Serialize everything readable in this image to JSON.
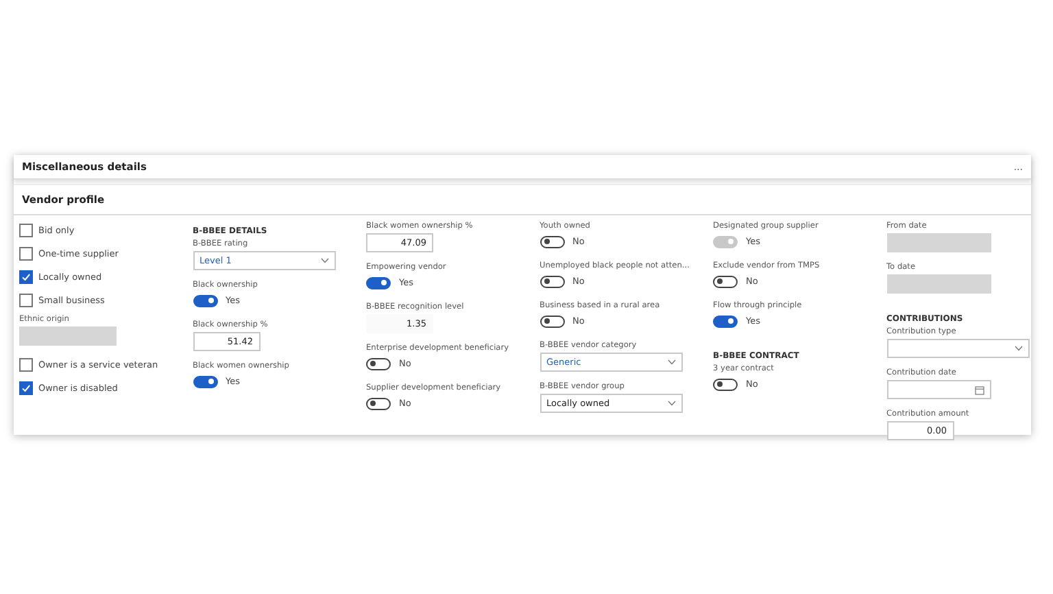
{
  "section": {
    "title": "Miscellaneous details",
    "more": "..."
  },
  "subsection": {
    "title": "Vendor profile"
  },
  "columns": [
    {
      "items": [
        {
          "kind": "checkbox",
          "label": "Bid only",
          "checked": false
        },
        {
          "kind": "checkbox",
          "label": "One-time supplier",
          "checked": false
        },
        {
          "kind": "checkbox",
          "label": "Locally owned",
          "checked": true
        },
        {
          "kind": "checkbox",
          "label": "Small business",
          "checked": false
        },
        {
          "kind": "field",
          "label": "Ethnic origin",
          "disabled": true
        },
        {
          "kind": "checkbox",
          "label": "Owner is a service veteran",
          "checked": false
        },
        {
          "kind": "checkbox",
          "label": "Owner is disabled",
          "checked": true
        }
      ]
    },
    {
      "items": [
        {
          "kind": "heading",
          "label": "B-BBEE DETAILS"
        },
        {
          "kind": "select",
          "label": "B-BBEE rating",
          "value": "Level 1",
          "accent": true
        },
        {
          "kind": "toggle",
          "label": "Black ownership",
          "on": true,
          "disabled": false,
          "text": "Yes"
        },
        {
          "kind": "number",
          "label": "Black ownership %",
          "value": "51.42"
        },
        {
          "kind": "toggle",
          "label": "Black women ownership",
          "on": true,
          "disabled": false,
          "text": "Yes"
        }
      ]
    },
    {
      "items": [
        {
          "kind": "number",
          "label": "Black women ownership %",
          "value": "47.09"
        },
        {
          "kind": "toggle",
          "label": "Empowering vendor",
          "on": true,
          "disabled": false,
          "text": "Yes"
        },
        {
          "kind": "readonly",
          "label": "B-BBEE recognition level",
          "value": "1.35"
        },
        {
          "kind": "toggle",
          "label": "Enterprise development beneficiary",
          "on": false,
          "disabled": false,
          "text": "No"
        },
        {
          "kind": "toggle",
          "label": "Supplier development beneficiary",
          "on": false,
          "disabled": false,
          "text": "No"
        }
      ]
    },
    {
      "items": [
        {
          "kind": "toggle",
          "label": "Youth owned",
          "on": false,
          "disabled": false,
          "text": "No"
        },
        {
          "kind": "toggle",
          "label": "Unemployed black people not atten...",
          "on": false,
          "disabled": false,
          "text": "No"
        },
        {
          "kind": "toggle",
          "label": "Business based in a rural area",
          "on": false,
          "disabled": false,
          "text": "No"
        },
        {
          "kind": "select",
          "label": "B-BBEE vendor category",
          "value": "Generic",
          "accent": true
        },
        {
          "kind": "select",
          "label": "B-BBEE vendor group",
          "value": "Locally owned",
          "accent": false
        }
      ]
    },
    {
      "items": [
        {
          "kind": "toggle",
          "label": "Designated group supplier",
          "on": true,
          "disabled": true,
          "text": "Yes"
        },
        {
          "kind": "toggle",
          "label": "Exclude vendor from TMPS",
          "on": false,
          "disabled": false,
          "text": "No"
        },
        {
          "kind": "toggle",
          "label": "Flow through principle",
          "on": true,
          "disabled": false,
          "text": "Yes"
        },
        {
          "kind": "heading",
          "label": "B-BBEE CONTRACT"
        },
        {
          "kind": "toggle",
          "label": "3 year contract",
          "on": false,
          "disabled": false,
          "text": "No"
        }
      ]
    },
    {
      "items": [
        {
          "kind": "field",
          "label": "From date",
          "disabled": true
        },
        {
          "kind": "field",
          "label": "To date",
          "disabled": true
        },
        {
          "kind": "heading",
          "label": "CONTRIBUTIONS"
        },
        {
          "kind": "select",
          "label": "Contribution type",
          "value": ""
        },
        {
          "kind": "date",
          "label": "Contribution date"
        },
        {
          "kind": "number",
          "label": "Contribution amount",
          "value": "0.00"
        }
      ]
    }
  ]
}
